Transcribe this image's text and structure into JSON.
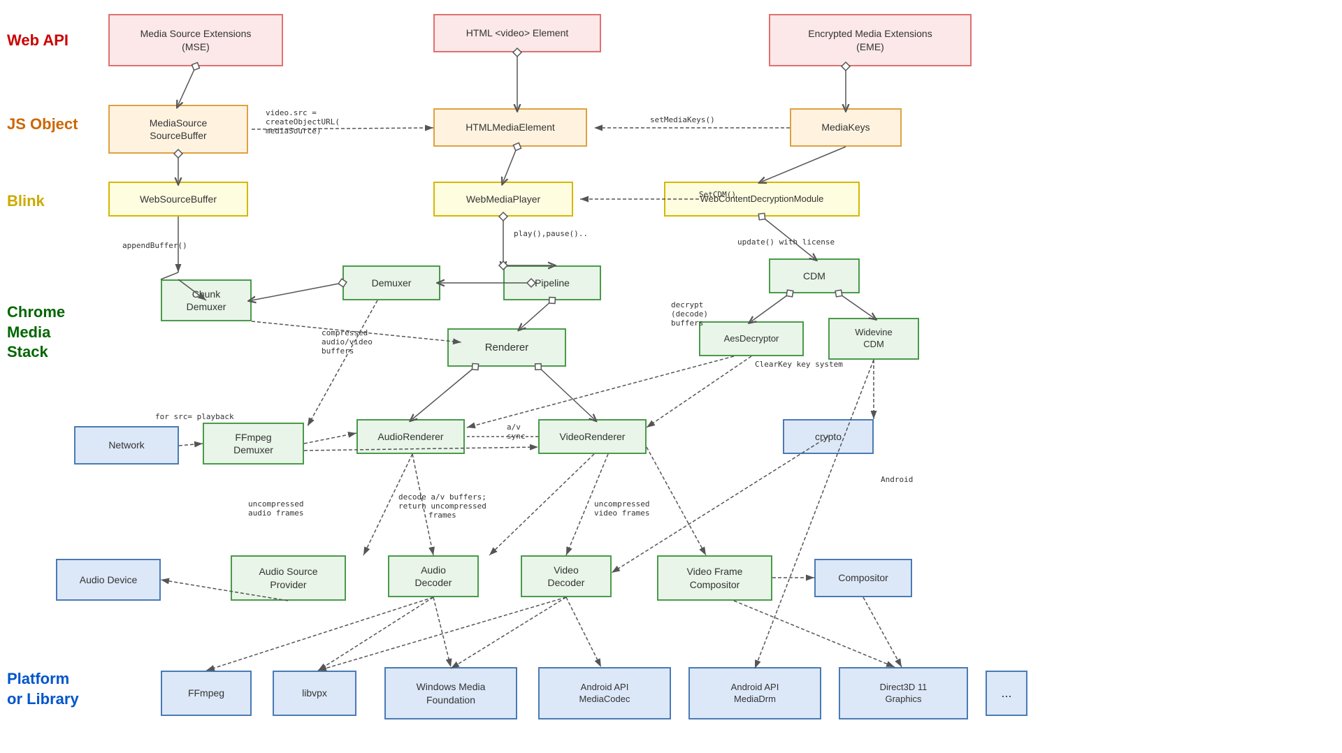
{
  "labels": {
    "webapi": "Web API",
    "jsobject": "JS Object",
    "blink": "Blink",
    "chrome_media_stack": "Chrome\nMedia\nStack",
    "platform_or_library": "Platform\nor Library"
  },
  "boxes": {
    "mse": "Media Source Extensions\n(MSE)",
    "html_video": "HTML <video> Element",
    "eme": "Encrypted Media Extensions\n(EME)",
    "mediasource": "MediaSource\nSourceBuffer",
    "htmlmediaelement": "HTMLMediaElement",
    "mediakeys": "MediaKeys",
    "websourcebuffer": "WebSourceBuffer",
    "webmediaplayer": "WebMediaPlayer",
    "webcontentdecryptionmodule": "WebContentDecryptionModule",
    "chunk_demuxer": "Chunk\nDemuxer",
    "demuxer": "Demuxer",
    "pipeline": "Pipeline",
    "cdm": "CDM",
    "renderer": "Renderer",
    "aesdecryptor": "AesDecryptor",
    "widevine_cdm": "Widevine\nCDM",
    "network": "Network",
    "ffmpeg_demuxer": "FFmpeg\nDemuxer",
    "audiorenderer": "AudioRenderer",
    "videorenderer": "VideoRenderer",
    "crypto": "crypto",
    "audio_device": "Audio Device",
    "audio_source_provider": "Audio Source\nProvider",
    "audio_decoder": "Audio\nDecoder",
    "video_decoder": "Video\nDecoder",
    "video_frame_compositor": "Video Frame\nCompositor",
    "compositor": "Compositor",
    "ffmpeg": "FFmpeg",
    "libvpx": "libvpx",
    "windows_media_foundation": "Windows Media\nFoundation",
    "android_api_mediacodec": "Android API\nMediaCodec",
    "android_api_mediadrm": "Android API\nMediaDrm",
    "direct3d_11_graphics": "Direct3D 11\nGraphics",
    "ellipsis": "..."
  },
  "annotations": {
    "video_src": "video.src =\ncreateObjectURL(\nmediaSource)",
    "set_media_keys": "setMediaKeys()",
    "append_buffer": "appendBuffer()",
    "set_cdm": "SetCDM()",
    "update_license": "update() with license",
    "play_pause": "play(),pause()..",
    "decrypt_buffers": "decrypt\n(decode)\nbuffers",
    "compressed_buffers": "compressed\naudio/video\nbuffers",
    "for_src_playback": "for src= playback",
    "uncompressed_audio": "uncompressed\naudio frames",
    "decode_av_buffers": "decode a/v buffers;\nreturn uncompressed\nframes",
    "uncompressed_video": "uncompressed\nvideo frames",
    "av_sync": "a/v\nsync",
    "clearkey": "ClearKey\nkey system",
    "android": "Android"
  }
}
